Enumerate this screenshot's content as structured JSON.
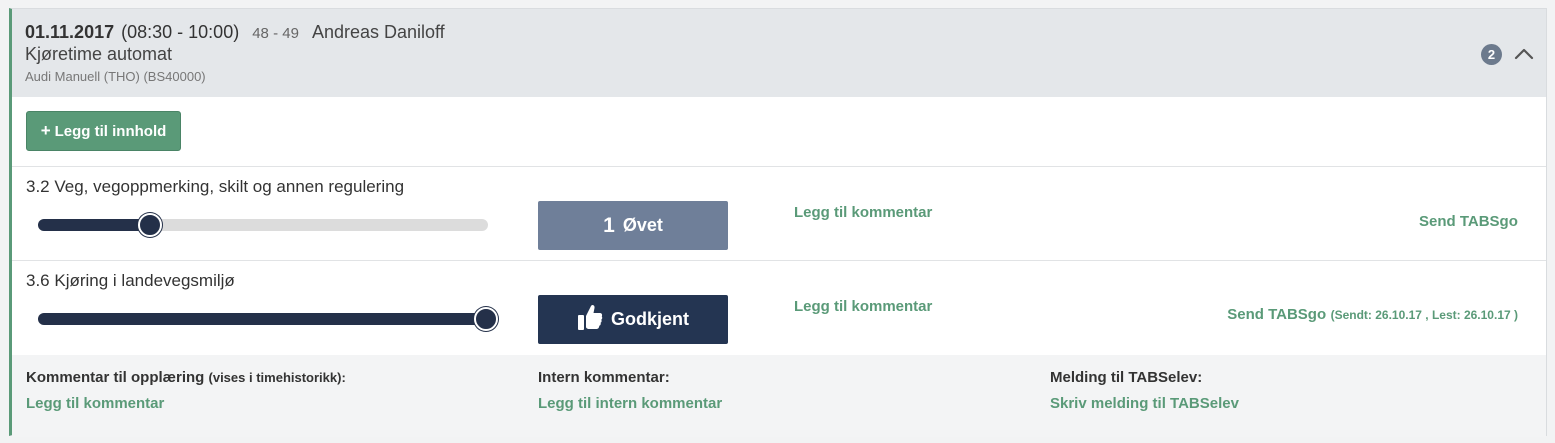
{
  "header": {
    "date": "01.11.2017",
    "time": "(08:30 - 10:00)",
    "lesson_numbers": "48 - 49",
    "student_name": "Andreas Daniloff",
    "lesson_type": "Kjøretime automat",
    "vehicle": "Audi Manuell (THO) (BS40000)",
    "badge_count": "2",
    "collapse_icon": "chevron-up-icon"
  },
  "add_content_button": {
    "icon": "plus-icon",
    "label": "Legg til innhold"
  },
  "items": [
    {
      "title": "3.2 Veg, vegoppmerking, skilt og annen regulering",
      "slider_level": 0.25,
      "status_count": "1",
      "status_label": "Øvet",
      "status_color": "#6f7f99",
      "comment_link": "Legg til kommentar",
      "send_link": "Send TABSgo",
      "send_info": ""
    },
    {
      "title": "3.6 Kjøring i landevegsmiljø",
      "slider_level": 1.0,
      "status_icon": "thumbs-up-icon",
      "status_label": "Godkjent",
      "status_color": "#243552",
      "comment_link": "Legg til kommentar",
      "send_link": "Send TABSgo",
      "send_info": "(Sendt: 26.10.17 , Lest: 26.10.17 )"
    }
  ],
  "footer": {
    "training_comment": {
      "label": "Kommentar til opplæring",
      "label_suffix": "(vises i timehistorikk):",
      "link": "Legg til kommentar"
    },
    "internal_comment": {
      "label": "Intern kommentar:",
      "link": "Legg til intern kommentar"
    },
    "message": {
      "label": "Melding til TABSelev:",
      "link": "Skriv melding til TABSelev"
    }
  },
  "colors": {
    "accent_green": "#5a9a78",
    "dark_navy": "#243049",
    "header_bg": "#e4e7ea"
  }
}
